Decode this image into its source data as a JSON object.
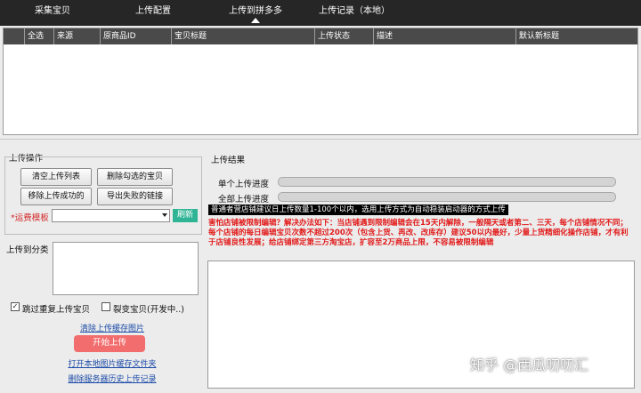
{
  "tabs": [
    {
      "label": "采集宝贝",
      "active": false
    },
    {
      "label": "上传配置",
      "active": false
    },
    {
      "label": "上传到拼多多",
      "active": true
    },
    {
      "label": "上传记录（本地）",
      "active": false
    }
  ],
  "table": {
    "columns": [
      "全选",
      "来源",
      "原商品ID",
      "宝贝标题",
      "上传状态",
      "描述",
      "默认新标题"
    ],
    "rows": []
  },
  "upload_ops": {
    "section_label": "上传操作",
    "clear_list": "清空上传列表",
    "delete_checked": "删除勾选的宝贝",
    "remove_success": "移除上传成功的",
    "export_failed": "导出失败的链接",
    "template_label": "*运费模板",
    "template_value": "",
    "refresh": "刷新",
    "category_label": "上传到分类",
    "skip_duplicate_checked": true,
    "skip_duplicate_label": "跳过重复上传宝贝",
    "split_checked": false,
    "split_label": "裂变宝贝(开发中..)",
    "clear_cache": "清除上传缓存图片",
    "start_upload": "开始上传",
    "open_folder": "打开本地图片缓存文件夹",
    "delete_history": "删除服务器历史上传记录"
  },
  "results": {
    "section_label": "上传结果",
    "single_label": "单个上传进度",
    "single_progress": 0,
    "total_label": "全部上传进度",
    "total_progress": 0,
    "notice_black": "普通者营店铺建议日上传数量1-100个以内，选用上传方式为自动稳装启动器的方式上传",
    "notice_red": "害怕店铺被限制编辑？解决办法如下：当店铺遇到限制编辑会在15天内解除，一般隔天或者第二、三天，每个店铺情况不同；每个店铺的每日编辑宝贝次数不超过200次（包含上货、再改、改库存）建议50以内最好，少量上货精细化操作店铺，才有利于店铺良性发展；给店铺绑定第三方淘宝店，扩容至2万商品上限，不容易被限制编辑"
  },
  "watermark": "知乎 @西瓜叨叨汇",
  "colors": {
    "topbar": "#262626",
    "table_header": "#4a4a4a",
    "refresh": "#2fb595",
    "start": "#f26d6d",
    "link": "#1c4ba8",
    "notice_red": "#e21919"
  }
}
